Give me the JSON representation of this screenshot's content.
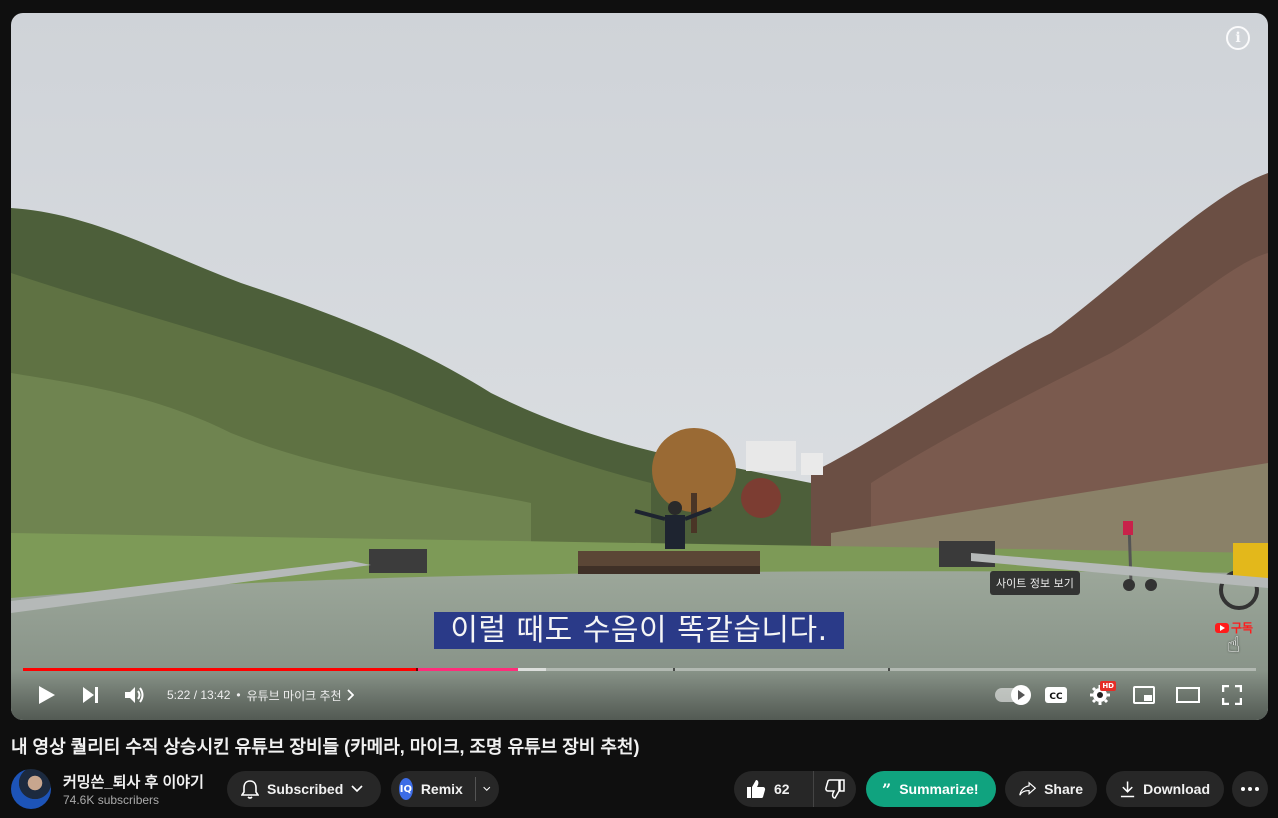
{
  "player": {
    "subtitle": "이럴 때도 수음이 똑같습니다.",
    "site_tooltip": "사이트 정보 보기",
    "watermark_label": "구독",
    "progress": {
      "played_fraction": 0.397,
      "buffered_fraction": 0.424
    },
    "time": "5:22 / 13:42",
    "chapter_sep": "•",
    "chapter": "유튜브 마이크 추천",
    "hd_badge": "HD"
  },
  "video": {
    "title": "내 영상 퀄리티 수직 상승시킨 유튜브 장비들 (카메라, 마이크, 조명 유튜브 장비 추천)"
  },
  "channel": {
    "name": "커밍쓴_퇴사 후 이야기",
    "subscribers": "74.6K subscribers"
  },
  "actions": {
    "subscribed": "Subscribed",
    "remix": "Remix",
    "remix_badge": "IQ",
    "likes": "62",
    "summarize": "Summarize!",
    "share": "Share",
    "download": "Download"
  },
  "colors": {
    "accent_red": "#ff0000",
    "summarize_green": "#10a37f",
    "caption_bg": "#2a3a88"
  }
}
